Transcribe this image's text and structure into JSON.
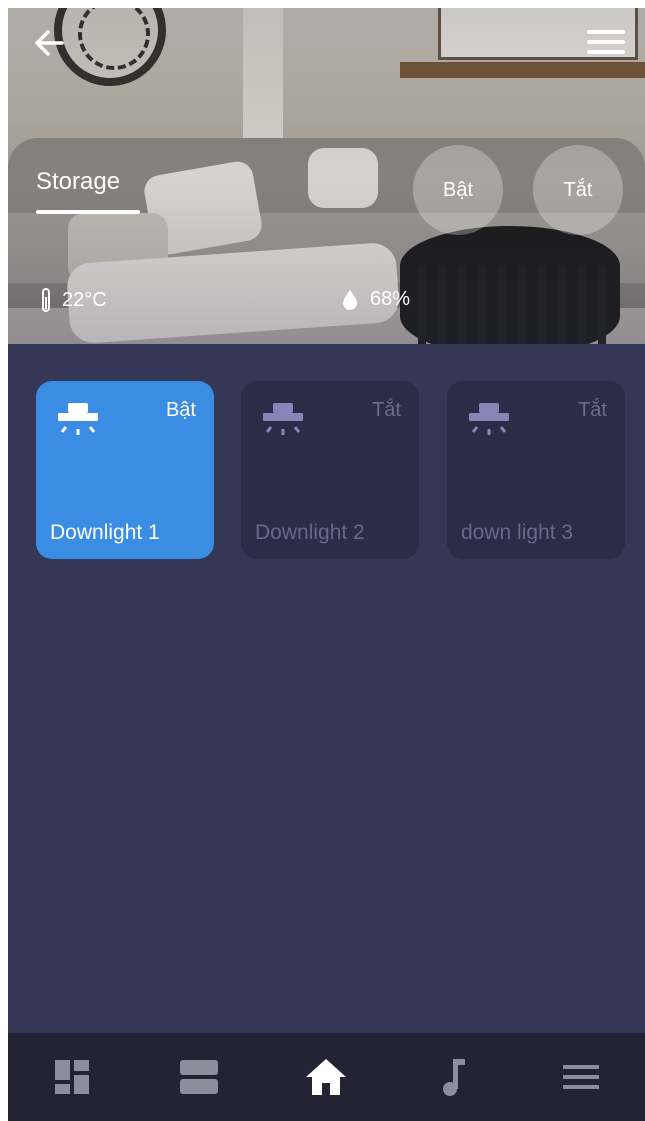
{
  "header": {
    "back_icon": "arrow-left-icon",
    "menu_icon": "hamburger-menu-icon",
    "room_name": "Storage",
    "all_on_label": "Bật",
    "all_off_label": "Tắt",
    "temperature": "22°C",
    "humidity": "68%"
  },
  "devices": [
    {
      "name": "Downlight 1",
      "state": "Bật",
      "active": true,
      "icon": "downlight-icon"
    },
    {
      "name": "Downlight 2",
      "state": "Tắt",
      "active": false,
      "icon": "downlight-icon"
    },
    {
      "name": "down light 3",
      "state": "Tắt",
      "active": false,
      "icon": "downlight-icon"
    }
  ],
  "bottom_nav": [
    {
      "icon": "dashboard-grid-icon",
      "active": false
    },
    {
      "icon": "rooms-list-icon",
      "active": false
    },
    {
      "icon": "home-icon",
      "active": true
    },
    {
      "icon": "music-note-icon",
      "active": false
    },
    {
      "icon": "menu-icon",
      "active": false
    }
  ],
  "colors": {
    "background": "#343755",
    "card_active": "#3b8de4",
    "card_inactive": "#2b2c46",
    "nav_background": "#232333",
    "nav_icon": "#8c8e9c",
    "nav_icon_active": "#ffffff"
  }
}
